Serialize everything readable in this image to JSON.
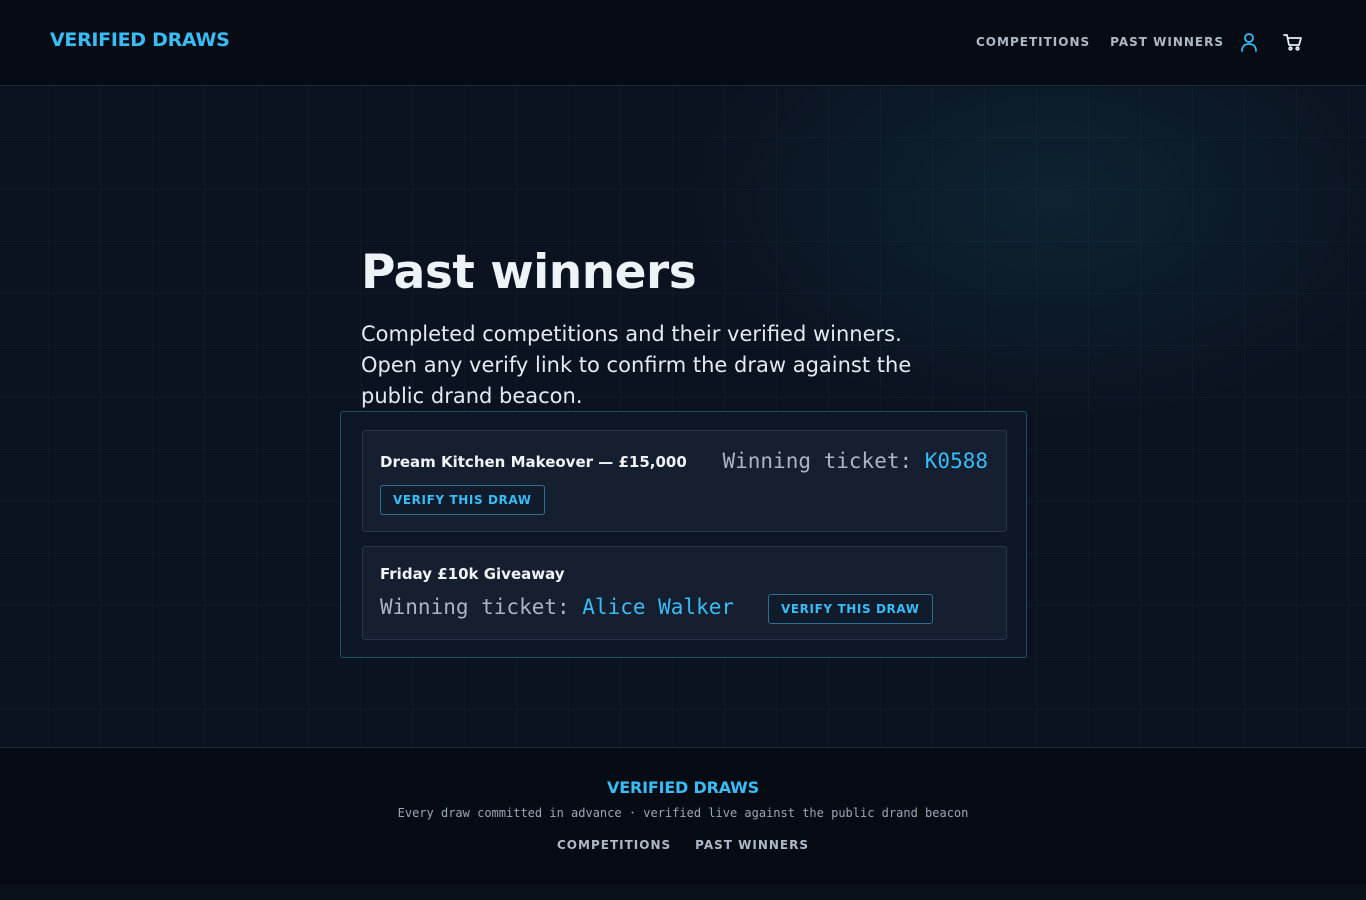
{
  "header": {
    "brand": "VERIFIED DRAWS",
    "nav": [
      "COMPETITIONS",
      "PAST WINNERS"
    ],
    "icons": [
      "user-icon",
      "cart-icon"
    ]
  },
  "page": {
    "title": "Past winners",
    "intro": "Completed competitions and their verified winners. Open any verify link to confirm the draw against the public drand beacon."
  },
  "winners": [
    {
      "competition": "Dream Kitchen Makeover — £15,000",
      "winner_label": "Winning ticket: ",
      "winner_value": "K0588",
      "verify_label": "VERIFY THIS DRAW"
    },
    {
      "competition": "Friday £10k Giveaway",
      "winner_label": "Winning ticket: ",
      "winner_value": "Alice Walker",
      "verify_label": "VERIFY THIS DRAW"
    }
  ],
  "footer": {
    "brand": "VERIFIED DRAWS",
    "tagline": "Every draw committed in advance · verified live against the public drand beacon",
    "links": [
      "COMPETITIONS",
      "PAST WINNERS"
    ]
  },
  "colors": {
    "accent": "#38bdf8",
    "background": "#0a1019",
    "card": "#151f2f"
  }
}
